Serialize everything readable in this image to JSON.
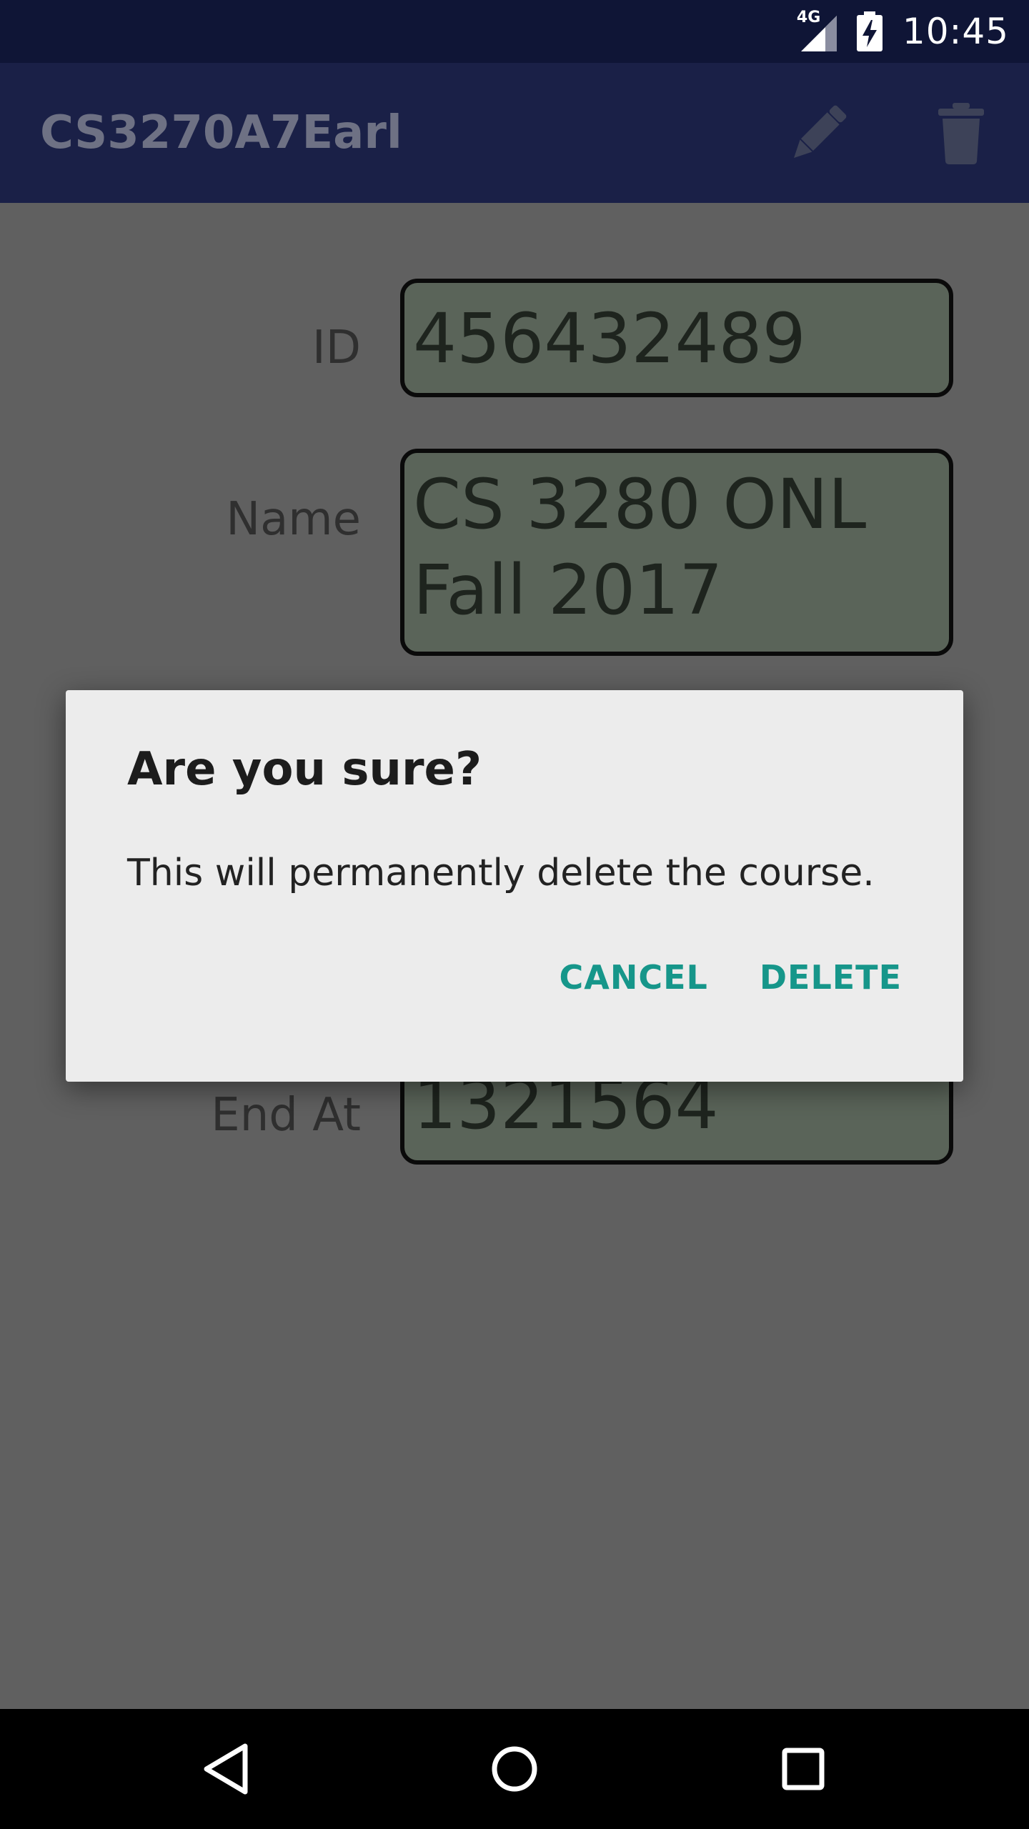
{
  "status_bar": {
    "network": "4G",
    "time": "10:45",
    "icons": [
      "signal-icon",
      "battery-charging-icon"
    ]
  },
  "app_bar": {
    "title": "CS3270A7Earl",
    "actions": [
      {
        "name": "edit",
        "icon": "pencil-icon"
      },
      {
        "name": "delete",
        "icon": "trash-icon"
      }
    ]
  },
  "form": {
    "id": {
      "label": "ID",
      "value": "456432489"
    },
    "name": {
      "label": "Name",
      "value": "CS 3280 ONL\nFall 2017"
    },
    "end_at": {
      "label": "End At",
      "value": "1321564"
    }
  },
  "dialog": {
    "title": "Are you sure?",
    "message": "This will permanently delete the course.",
    "cancel_label": "CANCEL",
    "delete_label": "DELETE",
    "accent_color": "#16968a"
  },
  "nav_bar": {
    "icons": [
      "back-icon",
      "home-icon",
      "recents-icon"
    ]
  },
  "colors": {
    "status_bar": "#0f1536",
    "app_bar": "#1a2047",
    "scrim_background": "#606060",
    "field_fill": "#5a6459"
  }
}
